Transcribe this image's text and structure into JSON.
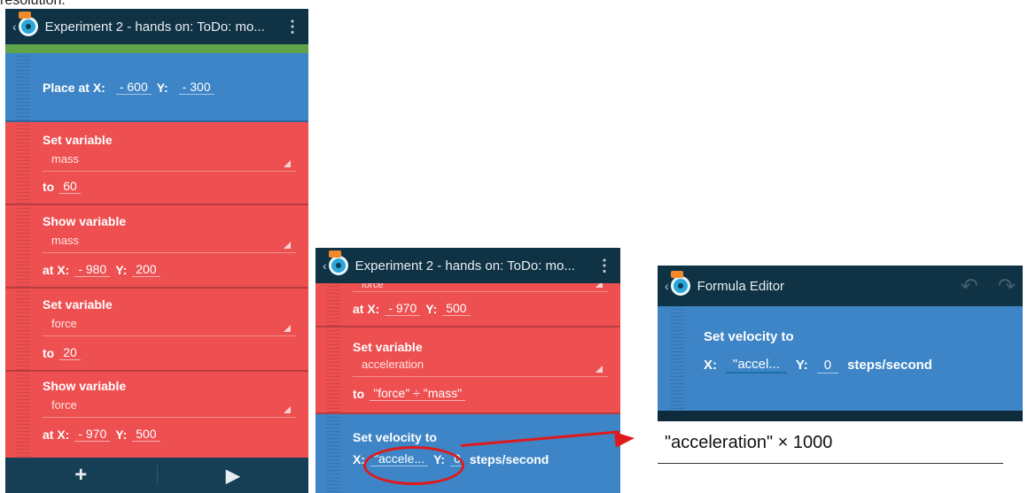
{
  "caption_partial": "resolution.",
  "screen1": {
    "title": "Experiment 2 - hands on: ToDo: mo...",
    "place_brick": {
      "label": "Place at X:",
      "x": "- 600",
      "y_label": "Y:",
      "y": "- 300"
    },
    "set_mass": {
      "title": "Set variable",
      "variable": "mass",
      "to_label": "to",
      "value": "60"
    },
    "show_mass": {
      "title": "Show variable",
      "variable": "mass",
      "at_label": "at X:",
      "x": "- 980",
      "y_label": "Y:",
      "y": "200"
    },
    "set_force": {
      "title": "Set variable",
      "variable": "force",
      "to_label": "to",
      "value": "20"
    },
    "show_force": {
      "title": "Show variable",
      "variable": "force",
      "at_label": "at X:",
      "x": "- 970",
      "y_label": "Y:",
      "y": "500"
    },
    "bottom": {
      "add": "+",
      "play": "▶"
    }
  },
  "screen2": {
    "title": "Experiment 2 - hands on: ToDo: mo...",
    "partial_var": "force",
    "show_force": {
      "at_label": "at X:",
      "x": "- 970",
      "y_label": "Y:",
      "y": "500"
    },
    "set_accel": {
      "title": "Set variable",
      "variable": "acceleration",
      "to_label": "to",
      "value": "\"force\" ÷ \"mass\""
    },
    "velocity": {
      "title": "Set velocity to",
      "x_label": "X:",
      "x": "\"accele...",
      "y_label": "Y:",
      "y": "0",
      "unit": "steps/second"
    }
  },
  "screen3": {
    "title": "Formula Editor",
    "velocity": {
      "title": "Set velocity to",
      "x_label": "X:",
      "x": "\"accel...",
      "y_label": "Y:",
      "y": "0",
      "unit": "steps/second"
    },
    "formula": "\"acceleration\" × 1000"
  },
  "colors": {
    "blue_brick": "#3d85c6",
    "red_brick": "#ee4f50",
    "actionbar": "#103245",
    "highlight": "#e0191d"
  }
}
